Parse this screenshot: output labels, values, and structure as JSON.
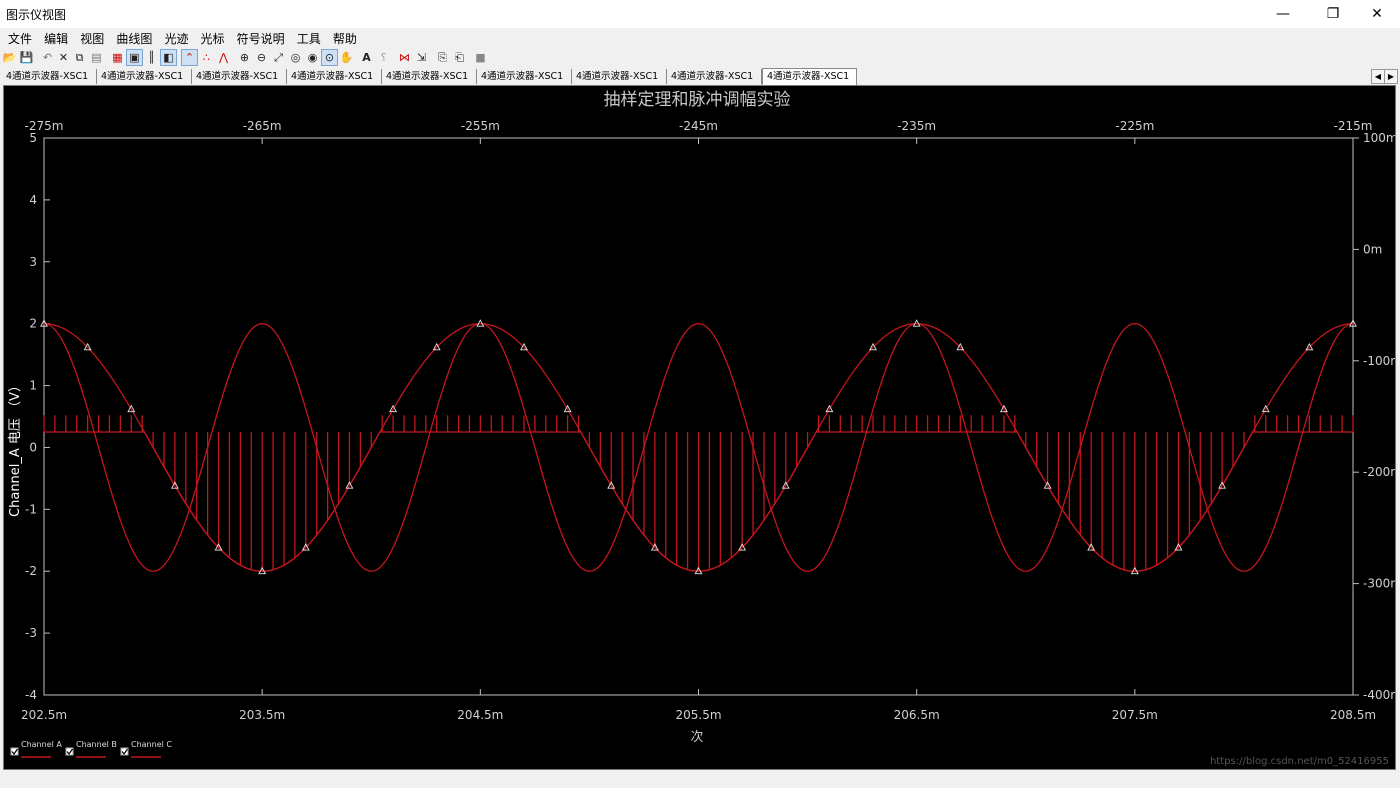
{
  "window": {
    "title": "图示仪视图",
    "buttons": [
      "—",
      "❐",
      "✕"
    ]
  },
  "menu": [
    "文件",
    "编辑",
    "视图",
    "曲线图",
    "光迹",
    "光标",
    "符号说明",
    "工具",
    "帮助"
  ],
  "toolbar_icons": [
    "open-icon",
    "save-icon",
    "undo-icon",
    "cut-icon",
    "copy-icon",
    "paste-icon",
    "grid-icon",
    "legend-icon",
    "cursors-icon",
    "reverse-colors-icon",
    "show-trace-icon",
    "dots-icon",
    "dots-lines-icon",
    "line-icon",
    "zoom-in-icon",
    "zoom-out-icon",
    "zoom-fit-icon",
    "zoom-x-icon",
    "zoom-y-icon",
    "zoom-area-icon",
    "pan-icon",
    "text-icon",
    "select-marks-icon",
    "overlay-icon",
    "export-icon",
    "copy-graph-icon",
    "paste-graph-icon",
    "stop-icon"
  ],
  "tabs": [
    "4通道示波器-XSC1",
    "4通道示波器-XSC1",
    "4通道示波器-XSC1",
    "4通道示波器-XSC1",
    "4通道示波器-XSC1",
    "4通道示波器-XSC1",
    "4通道示波器-XSC1",
    "4通道示波器-XSC1",
    "4通道示波器-XSC1"
  ],
  "active_tab": 8,
  "tab_scroll": [
    "◀",
    "▶"
  ],
  "chart_data": {
    "type": "line",
    "title": "抽样定理和脉冲调幅实验",
    "xlabel": "次",
    "ylabel": "Channel_A 电压 （V）",
    "xlim": [
      202.5,
      208.5
    ],
    "x_ticks": [
      "202.5m",
      "203.5m",
      "204.5m",
      "205.5m",
      "206.5m",
      "207.5m",
      "208.5m"
    ],
    "x2lim": [
      -275,
      -215
    ],
    "x2_ticks": [
      "-275m",
      "-265m",
      "-255m",
      "-245m",
      "-235m",
      "-225m",
      "-215m"
    ],
    "ylim": [
      -4,
      5
    ],
    "y_ticks": [
      "5",
      "4",
      "3",
      "2",
      "1",
      "0",
      "-1",
      "-2",
      "-3",
      "-4"
    ],
    "y2lim": [
      -400,
      100
    ],
    "y2_ticks": [
      "100m",
      "0m",
      "-100m",
      "-200m",
      "-300m",
      "-400m"
    ],
    "grid": false,
    "background": "#000000",
    "trace_color": "#c4161c",
    "series": [
      {
        "name": "Channel A",
        "kind": "sine",
        "amplitude": 2,
        "period_ms": 2.0,
        "phase_start_ms": 202.5,
        "offset": 0,
        "marker": "triangle",
        "marker_step_ms": 0.2
      },
      {
        "name": "Channel B",
        "kind": "sine",
        "amplitude": 2,
        "period_ms": 1.0,
        "phase_start_ms": 202.25,
        "offset": 0
      },
      {
        "name": "Channel C",
        "kind": "pulse",
        "pulse_step_ms": 0.05,
        "clip_level": 0.25,
        "pulse_top_positive": 0.52
      }
    ],
    "legend": {
      "placement": "bottom-left",
      "entries": [
        "Channel A",
        "Channel B",
        "Channel C"
      ]
    }
  },
  "watermark": "https://blog.csdn.net/m0_52416955"
}
